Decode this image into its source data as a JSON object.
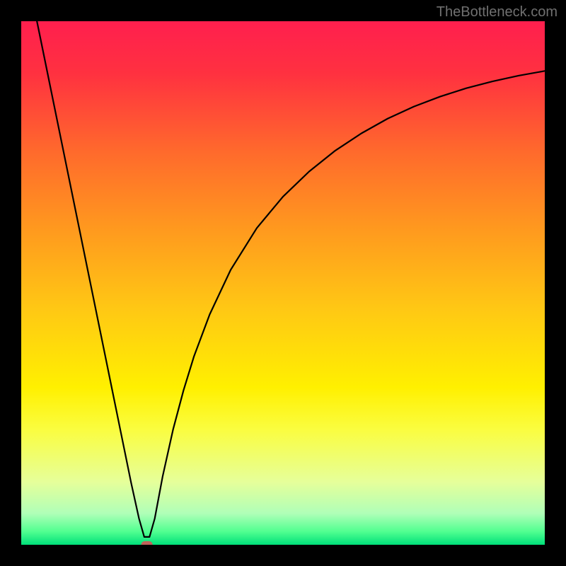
{
  "watermark": "TheBottleneck.com",
  "chart_data": {
    "type": "line",
    "title": "",
    "xlabel": "",
    "ylabel": "",
    "xlim": [
      0,
      100
    ],
    "ylim": [
      0,
      100
    ],
    "background_gradient": {
      "stops": [
        {
          "offset": 0.0,
          "color": "#ff1f4e"
        },
        {
          "offset": 0.1,
          "color": "#ff3140"
        },
        {
          "offset": 0.25,
          "color": "#ff6a2c"
        },
        {
          "offset": 0.4,
          "color": "#ff9a1e"
        },
        {
          "offset": 0.55,
          "color": "#ffc814"
        },
        {
          "offset": 0.7,
          "color": "#fff000"
        },
        {
          "offset": 0.78,
          "color": "#fafd40"
        },
        {
          "offset": 0.88,
          "color": "#e6ff9a"
        },
        {
          "offset": 0.94,
          "color": "#b0ffb8"
        },
        {
          "offset": 0.975,
          "color": "#50ff90"
        },
        {
          "offset": 1.0,
          "color": "#00e07a"
        }
      ]
    },
    "series": [
      {
        "name": "bottleneck-curve",
        "type": "line",
        "color": "#000000",
        "stroke_width": 2.2,
        "x": [
          3,
          5,
          7,
          9,
          11,
          13,
          15,
          17,
          19,
          21,
          22.5,
          23.5,
          24.5,
          25.5,
          27,
          29,
          31,
          33,
          36,
          40,
          45,
          50,
          55,
          60,
          65,
          70,
          75,
          80,
          85,
          90,
          95,
          100
        ],
        "y": [
          100,
          90.2,
          80.4,
          70.6,
          60.8,
          51.0,
          41.2,
          31.4,
          21.6,
          11.8,
          5.0,
          1.5,
          1.5,
          5.0,
          13.0,
          22.0,
          29.5,
          36.0,
          44.0,
          52.5,
          60.5,
          66.5,
          71.3,
          75.3,
          78.6,
          81.4,
          83.7,
          85.6,
          87.2,
          88.5,
          89.6,
          90.5
        ]
      }
    ],
    "marker": {
      "name": "optimal-point",
      "shape": "rounded-rect",
      "x": 24,
      "y": 0,
      "width_units": 2.2,
      "height_units": 1.4,
      "fill": "#c0625a"
    }
  }
}
